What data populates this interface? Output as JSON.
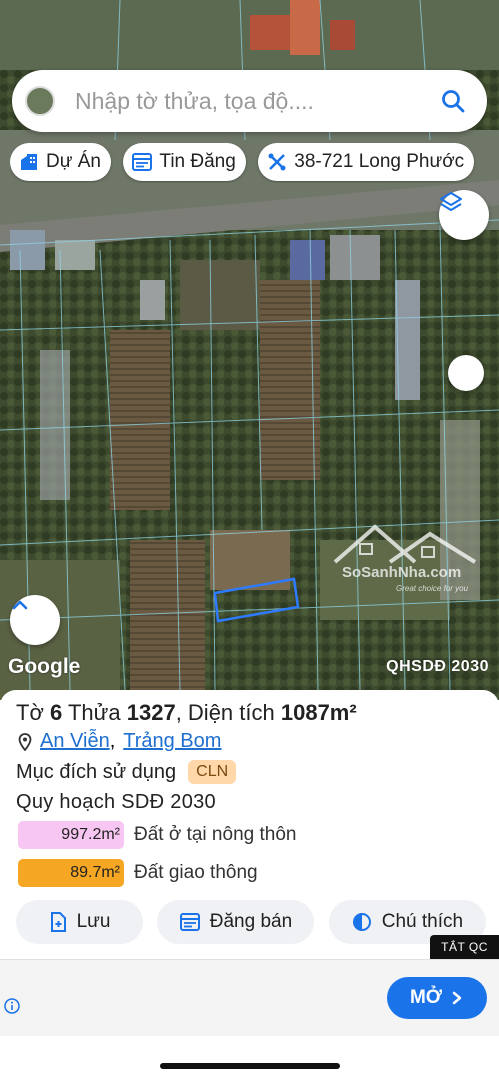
{
  "search": {
    "placeholder": "Nhập tờ thửa, tọa độ...."
  },
  "chips": [
    {
      "label": "Dự Án",
      "icon": "building-icon"
    },
    {
      "label": "Tin Đăng",
      "icon": "listing-icon"
    },
    {
      "label": "38-721 Long Phước",
      "icon": "ruler-icon"
    }
  ],
  "map": {
    "attribution": "Google",
    "plan_label": "QHSDĐ 2030",
    "watermark": {
      "brand": "SoSanhNha.com",
      "tagline": "Great choice for you"
    }
  },
  "parcel": {
    "sheet_prefix": "Tờ",
    "sheet": "6",
    "plot_prefix": "Thửa",
    "plot": "1327",
    "area_prefix": ", Diện tích",
    "area": "1087m²",
    "ward": "An Viễn",
    "separator": ",",
    "district": "Trảng Bom",
    "purpose_label": "Mục đích sử dụng",
    "purpose_code": "CLN",
    "plan_title": "Quy hoạch SDĐ 2030",
    "zones": [
      {
        "area": "997.2m²",
        "label": "Đất ở tại nông thôn",
        "color": "#f7c6f2"
      },
      {
        "area": "89.7m²",
        "label": "Đất giao thông",
        "color": "#f5a623"
      }
    ]
  },
  "actions": [
    {
      "label": "Lưu",
      "icon": "bookmark-add-icon"
    },
    {
      "label": "Đăng bán",
      "icon": "listing-icon"
    },
    {
      "label": "Chú thích",
      "icon": "legend-icon"
    }
  ],
  "ad": {
    "close_label": "TẮT QC",
    "open_label": "MỞ"
  },
  "colors": {
    "accent": "#1a73e8",
    "link": "#1e6fd0",
    "parcel_outline": "#2f7bff"
  }
}
